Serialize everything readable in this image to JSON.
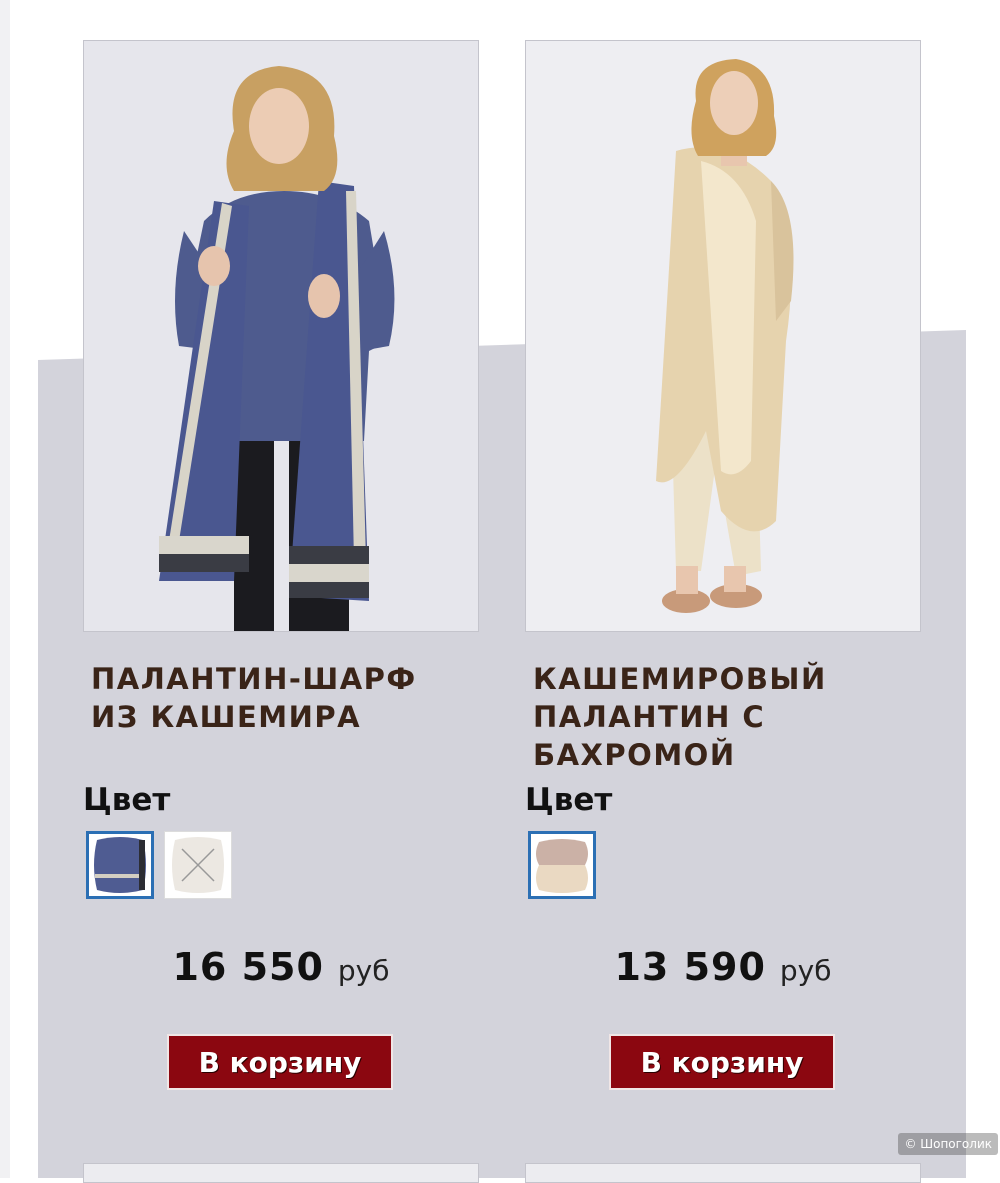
{
  "products": [
    {
      "title": "ПАЛАНТИН-ШАРФ ИЗ КАШЕМИРА",
      "color_label": "Цвет",
      "swatches": [
        {
          "name": "blue-grey",
          "selected": true,
          "available": true
        },
        {
          "name": "light-beige",
          "selected": false,
          "available": false
        }
      ],
      "price_amount": "16 550",
      "price_currency": "руб",
      "cart_label": "В корзину"
    },
    {
      "title": "КАШЕМИРОВЫЙ ПАЛАНТИН С БАХРОМОЙ",
      "color_label": "Цвет",
      "swatches": [
        {
          "name": "beige",
          "selected": true,
          "available": true
        }
      ],
      "price_amount": "13 590",
      "price_currency": "руб",
      "cart_label": "В корзину"
    }
  ],
  "watermark": "© Шопоголик",
  "colors": {
    "button_bg": "#8b0710",
    "panel_bg": "#d3d3db",
    "title_text": "#3a2418",
    "swatch_selected_border": "#2b6fb4"
  }
}
